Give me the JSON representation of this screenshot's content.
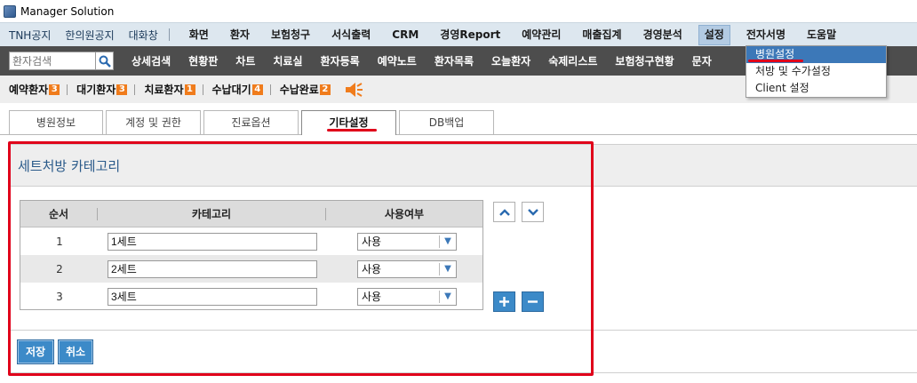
{
  "window": {
    "title": "Manager Solution"
  },
  "top_menu": {
    "left_items": [
      "TNH공지",
      "한의원공지",
      "대화창"
    ],
    "main_items": [
      "화면",
      "환자",
      "보험청구",
      "서식출력",
      "CRM",
      "경영Report",
      "예약관리",
      "매출집계",
      "경영분석",
      "설정",
      "전자서명",
      "도움말"
    ],
    "active_item": "설정"
  },
  "nav": {
    "search_placeholder": "환자검색",
    "items": [
      "상세검색",
      "현황판",
      "차트",
      "치료실",
      "환자등록",
      "예약노트",
      "환자목록",
      "오늘환자",
      "숙제리스트",
      "보험청구현황",
      "문자"
    ]
  },
  "settings_dropdown": {
    "items": [
      "병원설정",
      "처방 및 수가설정",
      "Client 설정"
    ],
    "highlighted": "병원설정"
  },
  "status": {
    "items": [
      {
        "label": "예약환자",
        "count": "3"
      },
      {
        "label": "대기환자",
        "count": "3"
      },
      {
        "label": "치료환자",
        "count": "1"
      },
      {
        "label": "수납대기",
        "count": "4"
      },
      {
        "label": "수납완료",
        "count": "2"
      }
    ]
  },
  "tabs": {
    "items": [
      "병원정보",
      "계정 및 권한",
      "진료옵션",
      "기타설정",
      "DB백업"
    ],
    "active": "기타설정"
  },
  "panel": {
    "title": "세트처방 카테고리",
    "columns": {
      "order": "순서",
      "category": "카테고리",
      "usage": "사용여부"
    },
    "rows": [
      {
        "order": "1",
        "category": "1세트",
        "usage": "사용"
      },
      {
        "order": "2",
        "category": "2세트",
        "usage": "사용"
      },
      {
        "order": "3",
        "category": "3세트",
        "usage": "사용"
      }
    ],
    "buttons": {
      "save": "저장",
      "cancel": "취소"
    }
  },
  "icons": {
    "search": "magnifier-icon",
    "move_up": "chevron-up-icon",
    "move_down": "chevron-down-icon",
    "add": "plus-icon",
    "remove": "minus-icon",
    "speaker": "speaker-icon",
    "select_arrow": "triangle-down-icon"
  },
  "colors": {
    "accent": "#3c8ac8",
    "highlight_red": "#e0001a",
    "badge_orange": "#f07c1c",
    "nav_dark": "#4d4d4d",
    "menu_blue": "#dde7ef"
  }
}
